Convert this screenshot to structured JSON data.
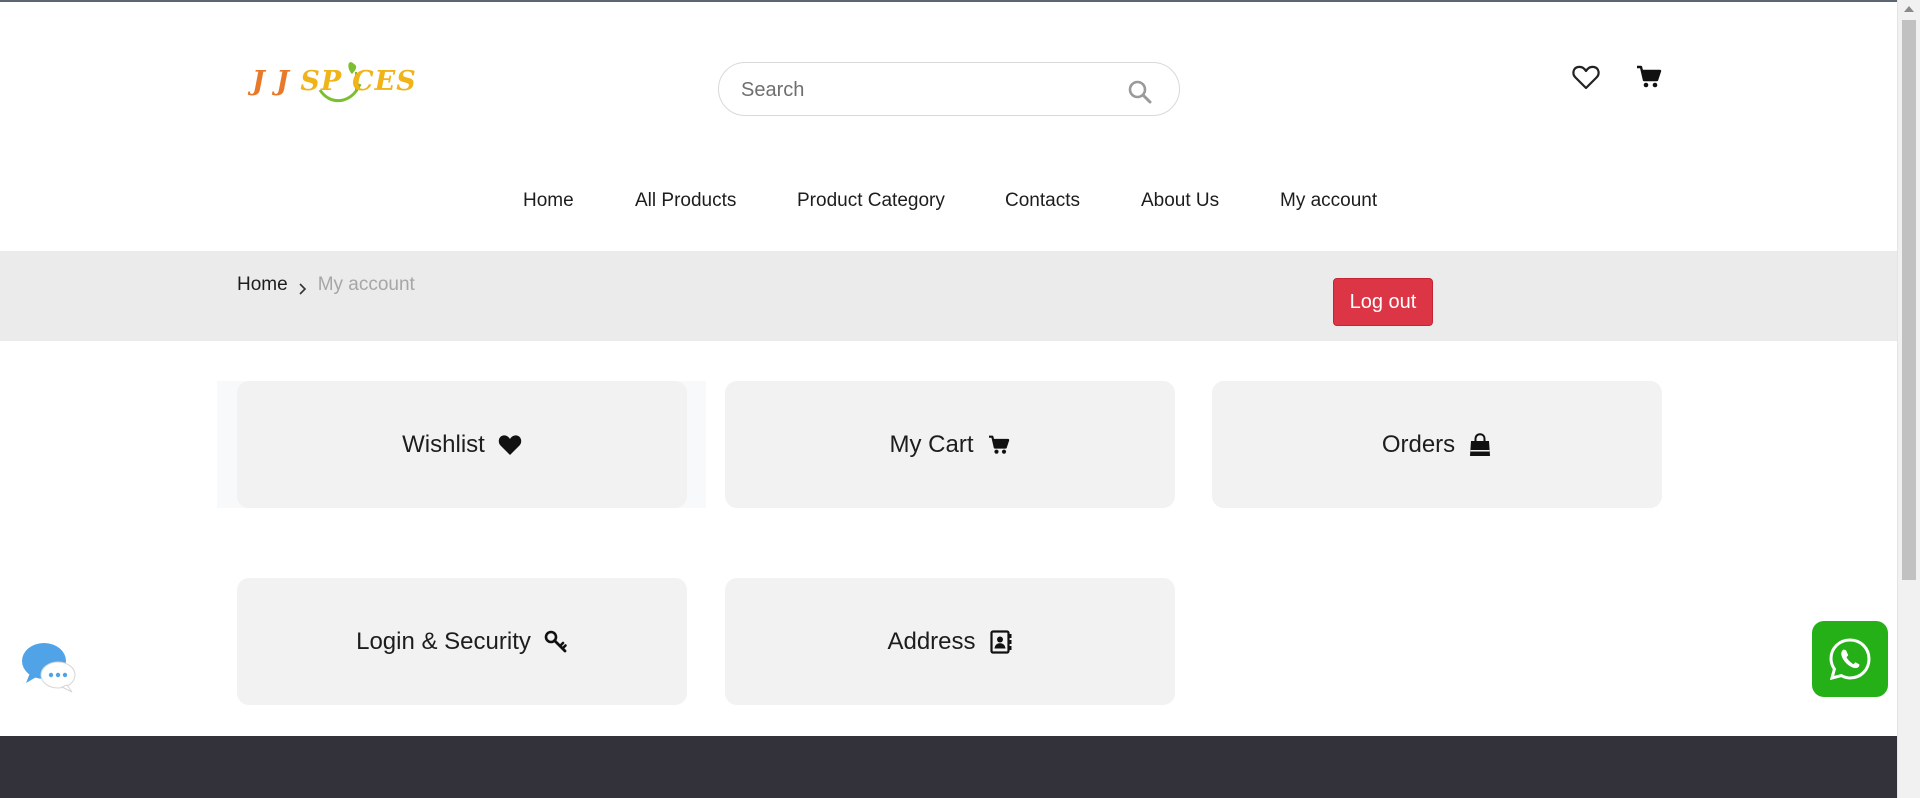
{
  "header": {
    "logo": {
      "text_part1": "J J ",
      "text_part2": "SP",
      "text_part3": "CES",
      "alt": "J J SPICES"
    },
    "search": {
      "placeholder": "Search",
      "value": ""
    },
    "icons": [
      "heart-outline-icon",
      "cart-icon"
    ]
  },
  "nav": {
    "items": [
      {
        "label": "Home"
      },
      {
        "label": "All Products"
      },
      {
        "label": "Product Category"
      },
      {
        "label": "Contacts"
      },
      {
        "label": "About Us"
      },
      {
        "label": "My account"
      }
    ]
  },
  "breadcrumb": {
    "home": "Home",
    "current": "My account"
  },
  "account": {
    "logout_label": "Log out",
    "cards": [
      {
        "label": "Wishlist",
        "icon": "heart-icon"
      },
      {
        "label": "My Cart",
        "icon": "cart-icon"
      },
      {
        "label": "Orders",
        "icon": "shopping-bag-icon"
      },
      {
        "label": "Login & Security",
        "icon": "key-icon"
      },
      {
        "label": "Address",
        "icon": "address-book-icon"
      }
    ]
  },
  "widgets": {
    "chat": {
      "icon": "chat-bubbles-icon"
    },
    "whatsapp": {
      "icon": "whatsapp-icon"
    }
  },
  "colors": {
    "accent_logout": "#dc3545",
    "whatsapp_green": "#25b017",
    "footer_bg": "#33313a",
    "breadcrumb_bg": "#ebebeb",
    "card_bg": "#f2f2f2",
    "logo_orange": "#e8792b",
    "logo_yellow": "#f0b419"
  }
}
